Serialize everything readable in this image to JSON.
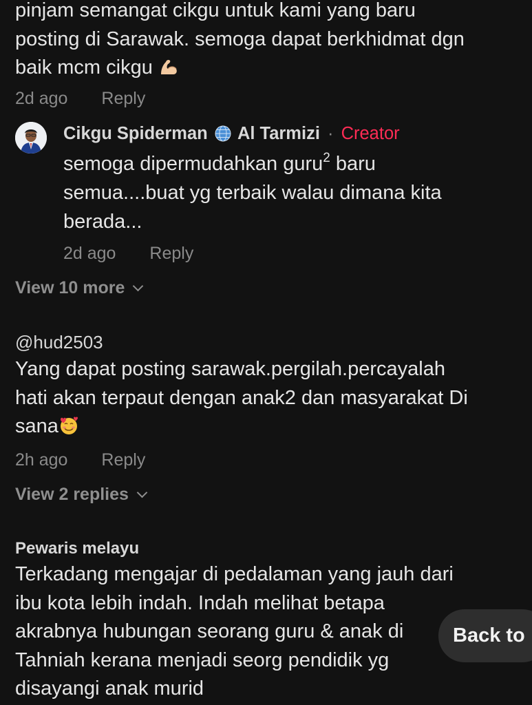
{
  "comment1": {
    "line1": "pinjam semangat cikgu untuk kami yang baru",
    "line2": "posting di Sarawak. semoga dapat berkhidmat dgn",
    "line3": "baik mcm cikgu",
    "emoji": "flexed-biceps",
    "time": "2d ago",
    "reply_label": "Reply"
  },
  "creator_reply": {
    "name": "Cikgu Spiderman",
    "name2": "Al Tarmizi",
    "separator": "·",
    "badge": "Creator",
    "badge_color": "#fe2c55",
    "text_part1": "semoga dipermudahkan guru",
    "superscript": "2",
    "text_part2": " baru",
    "line2": "semua....buat yg terbaik walau dimana kita",
    "line3": "berada...",
    "time": "2d ago",
    "reply_label": "Reply"
  },
  "view_more_1": "View 10 more",
  "comment2": {
    "username": "@hud2503",
    "line1": "Yang dapat posting sarawak.pergilah.percayalah",
    "line2": "hati akan terpaut dengan anak2 dan masyarakat Di",
    "line3": "sana",
    "emoji": "smiling-face-with-hearts",
    "time": "2h ago",
    "reply_label": "Reply"
  },
  "view_replies_2": "View 2 replies",
  "comment3": {
    "username": "Pewaris melayu",
    "line1": "Terkadang mengajar di pedalaman yang jauh dari",
    "line2": "ibu kota lebih indah. Indah melihat betapa",
    "line3": "akrabnya hubungan seorang guru & anak di",
    "line4": "Tahniah kerana menjadi seorg pendidik yg",
    "line5": "disayangi anak murid"
  },
  "back_button": "Back to"
}
